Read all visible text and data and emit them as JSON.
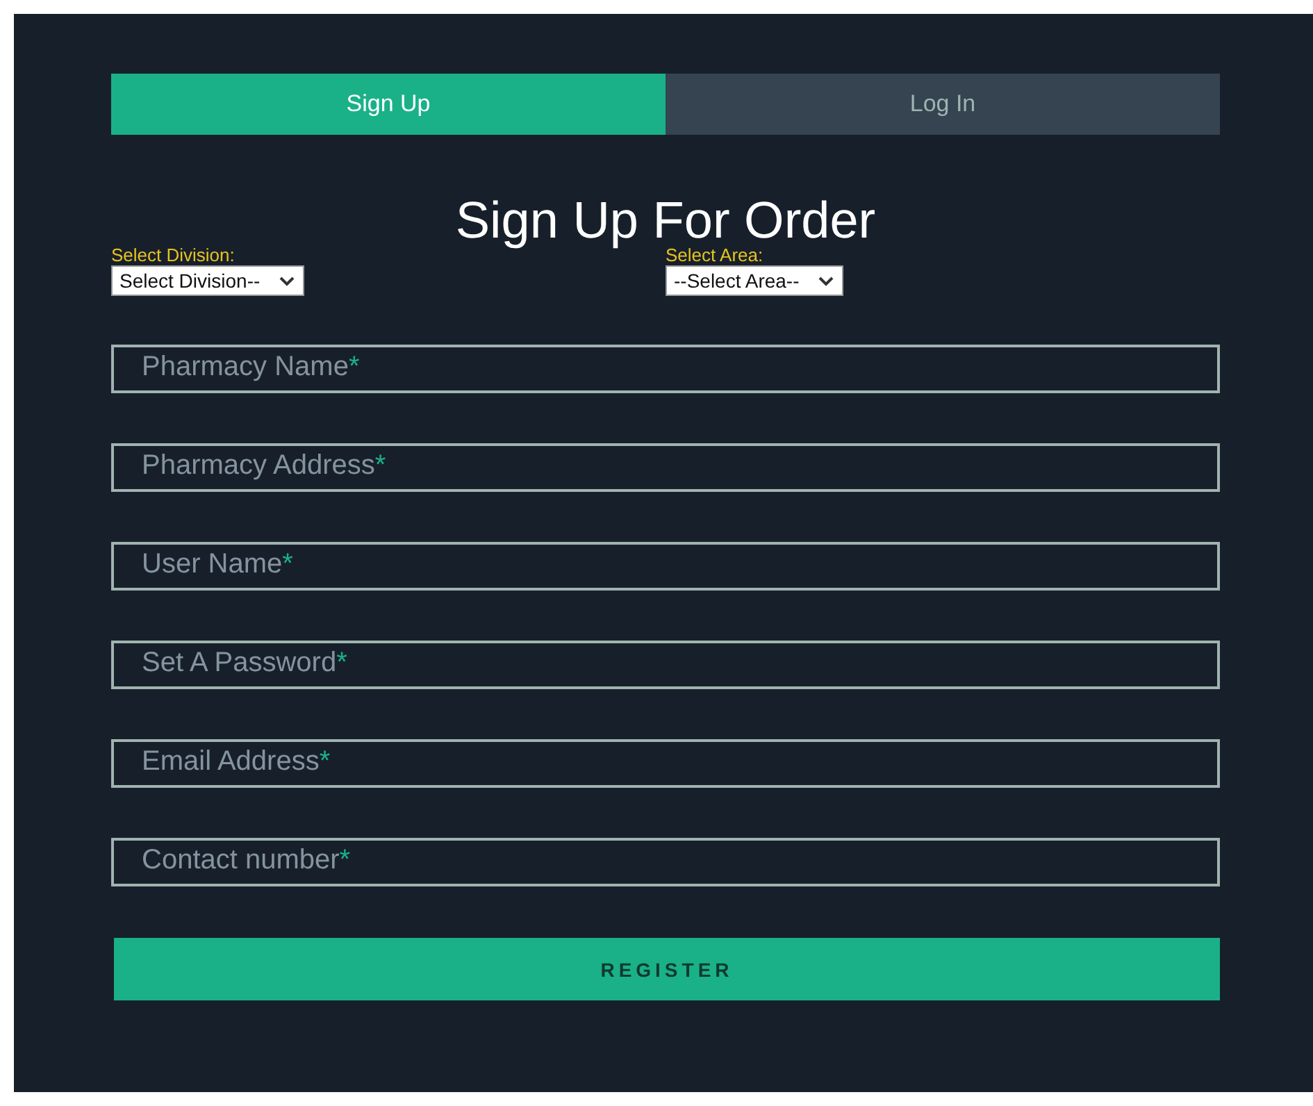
{
  "tabs": [
    {
      "label": "Sign Up",
      "selected": true
    },
    {
      "label": "Log In",
      "selected": false
    }
  ],
  "title": "Sign Up For Order",
  "selects": [
    {
      "label": "Select Division:",
      "value": "Select Division--"
    },
    {
      "label": "Select Area:",
      "value": "--Select Area--"
    }
  ],
  "fields": [
    {
      "placeholder": "Pharmacy Name",
      "required_mark": "*"
    },
    {
      "placeholder": "Pharmacy Address",
      "required_mark": "*"
    },
    {
      "placeholder": "User Name",
      "required_mark": "*"
    },
    {
      "placeholder": "Set A Password",
      "required_mark": "*"
    },
    {
      "placeholder": "Email Address",
      "required_mark": "*"
    },
    {
      "placeholder": "Contact number",
      "required_mark": "*"
    }
  ],
  "submit": "REGISTER"
}
